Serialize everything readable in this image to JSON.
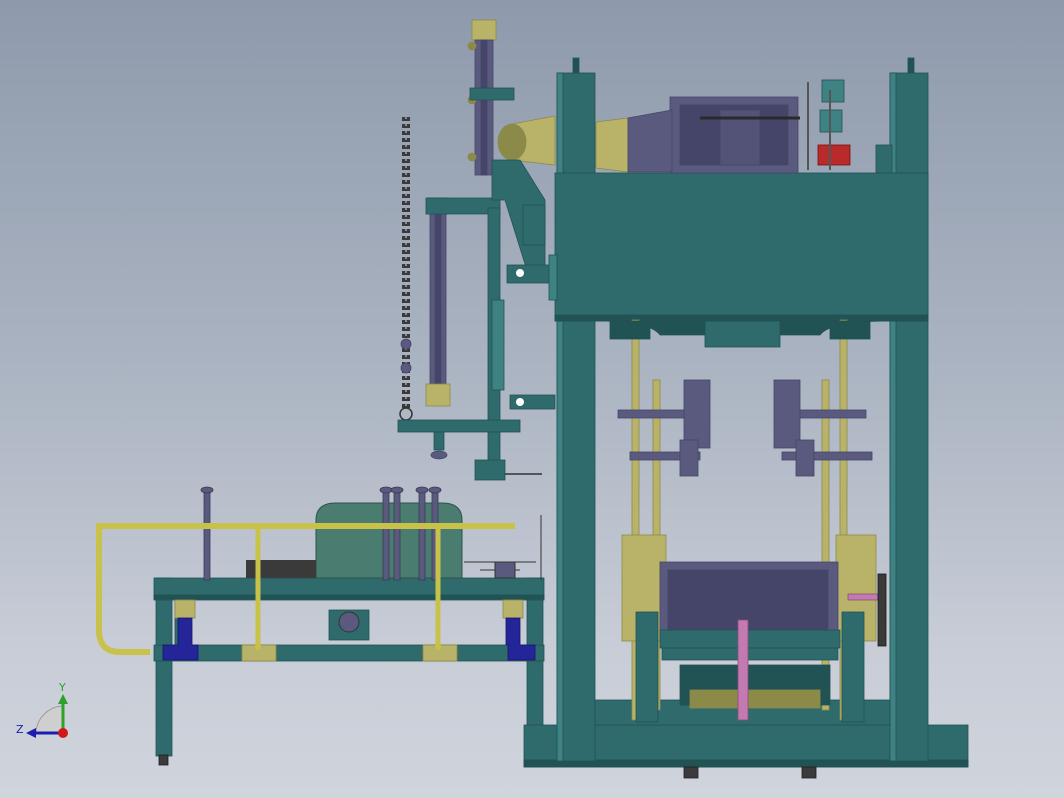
{
  "window": {
    "title": ""
  },
  "colors": {
    "frame": "#2f6b6c",
    "frame_dark": "#215354",
    "frame_light": "#3f8283",
    "motor": "#5a5a7e",
    "motor_dark": "#45456a",
    "brass": "#b9b36a",
    "brass_dark": "#8c8a48",
    "rail": "#c9c24a",
    "rail_dark": "#9a9230",
    "navy": "#25259a",
    "pink": "#c27ab0",
    "red": "#b92a2a",
    "chain": "#3a3a3a",
    "foot": "#3b3b3b"
  },
  "triad": {
    "y_label": "Y",
    "z_label": "Z",
    "y_color": "#2da02d",
    "z_color": "#1c1cb0",
    "x_color": "#d01818"
  }
}
